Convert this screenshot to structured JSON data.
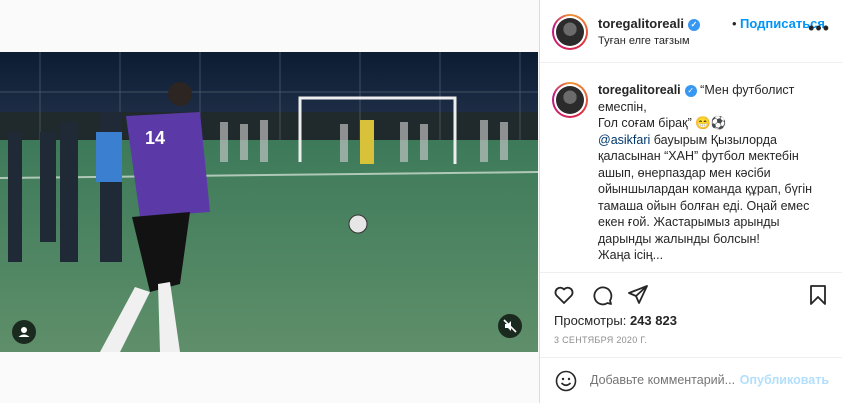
{
  "header": {
    "username": "toregalitoreali",
    "dot": "•",
    "follow_label": "Подписаться",
    "location": "Туған елге тағзым"
  },
  "caption": {
    "username": "toregalitoreali",
    "line1": "“Мен футболист емеспін,",
    "line2": "Гол соғам бірақ”",
    "mention": "@asikfari",
    "body": " бауырым Қызылорда қаласынан “ХАН” футбол мектебін ашып, өнерпаздар мен кәсіби ойыншылардан команда құрап, бүгін тамаша ойын болған еді. Оңай емес екен ғой. Жастарымыз арынды дарынды жалынды болсын!",
    "trailing": "Жаңа ісің..."
  },
  "stats": {
    "views_label": "Просмотры:",
    "views_value": "243 823",
    "date": "3 СЕНТЯБРЯ 2020 Г."
  },
  "comment": {
    "placeholder": "Добавьте комментарий...",
    "publish_label": "Опубликовать"
  },
  "colors": {
    "accent": "#0095f6",
    "verified": "#3897f0",
    "publish_disabled": "#b2dffc"
  },
  "icons": [
    "more-options-icon",
    "verified-icon",
    "heart-icon",
    "comment-icon",
    "share-icon",
    "bookmark-icon",
    "emoji-icon",
    "mute-icon",
    "user-tag-icon"
  ]
}
